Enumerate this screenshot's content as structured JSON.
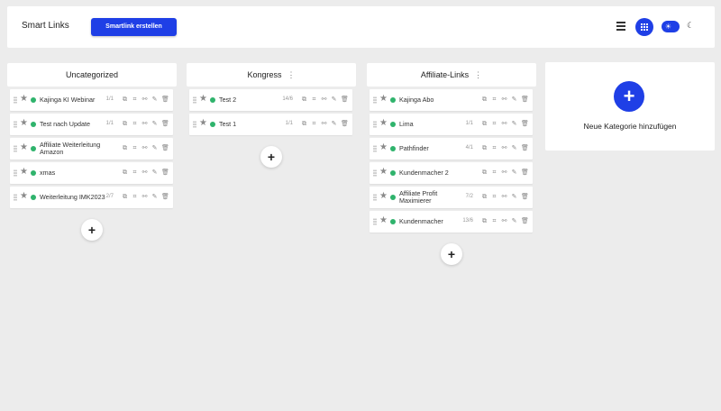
{
  "header": {
    "title": "Smart Links",
    "create_button": "Smartlink erstellen",
    "icons": [
      "menu-icon",
      "grid-icon",
      "theme-toggle-sun-icon",
      "moon-icon"
    ]
  },
  "colors": {
    "accent": "#1f3fe6",
    "status_active": "#2fb36c",
    "background": "#ececec"
  },
  "columns": [
    {
      "title": "Uncategorized",
      "has_menu": false,
      "links": [
        {
          "name": "Kajinga KI Webinar",
          "count": "1/1"
        },
        {
          "name": "Test nach Update",
          "count": "1/1"
        },
        {
          "name": "Affiliate Weiterleitung Amazon",
          "count": ""
        },
        {
          "name": "xmas",
          "count": ""
        },
        {
          "name": "Weiterleitung IMK2023",
          "count": "2/7"
        }
      ]
    },
    {
      "title": "Kongress",
      "has_menu": true,
      "links": [
        {
          "name": "Test 2",
          "count": "14/6"
        },
        {
          "name": "Test 1",
          "count": "1/1"
        }
      ]
    },
    {
      "title": "Affiliate-Links",
      "has_menu": true,
      "links": [
        {
          "name": "Kajinga Abo",
          "count": ""
        },
        {
          "name": "Lima",
          "count": "1/1"
        },
        {
          "name": "Pathfinder",
          "count": "4/1"
        },
        {
          "name": "Kundenmacher 2",
          "count": ""
        },
        {
          "name": "Affiliate Profit Maximierer",
          "count": "7/2"
        },
        {
          "name": "Kundenmacher",
          "count": "13/6"
        }
      ]
    }
  ],
  "new_category": {
    "label": "Neue Kategorie hinzufügen",
    "plus": "+"
  },
  "add_symbol": "+",
  "kebab_symbol": "⋮"
}
